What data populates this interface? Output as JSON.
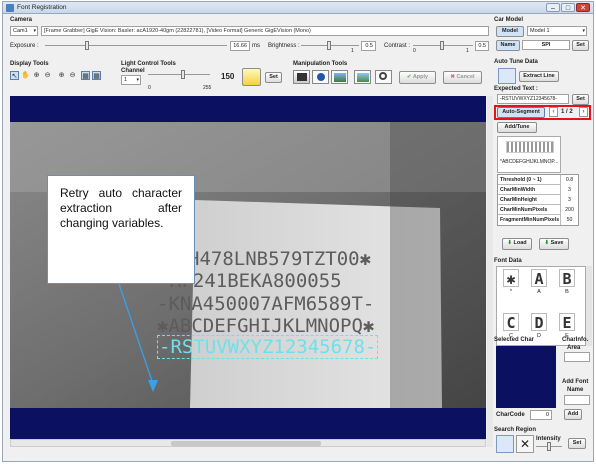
{
  "window": {
    "title": "Font Registration",
    "minimize": "–",
    "maximize": "□",
    "close": "✕"
  },
  "camera": {
    "section_label": "Camera",
    "selected": "Cam1",
    "info": "[Frame Grabber] GigE Vision: Basler: acA1920-40gm (22822781),   [Video Format] Generic GigEVision (Mono)",
    "exposure_label": "Exposure :",
    "exposure_value": "16.66",
    "exposure_unit": "ms",
    "brightness_label": "Brightness :",
    "brightness_value": "0.5",
    "brightness_min": "1",
    "contrast_label": "Contrast :",
    "contrast_value": "0.5",
    "contrast_min": "0",
    "contrast_max": "1"
  },
  "display_tools": {
    "label": "Display Tools"
  },
  "light_control": {
    "label": "Light Control Tools",
    "channel_label": "Channel",
    "channel_value": "1",
    "min": "0",
    "max": "255",
    "level_value": "150",
    "set_label": "Set"
  },
  "manipulation": {
    "label": "Manipulation Tools",
    "apply_label": "Apply",
    "cancel_label": "Cancel"
  },
  "image": {
    "lines": [
      "H478LNB579TZT00✱",
      "AF241BEKA800055",
      "-KNA450007AFM6589T-",
      "✱ABCDEFGHIJKLMNOPQ✱",
      "-RSTUVWXYZ12345678-"
    ]
  },
  "callout": {
    "text": "Retry auto character extraction after changing variables."
  },
  "car_model": {
    "label": "Car Model",
    "model_tab": "Model",
    "model_value": "Model 1",
    "name_tab": "Name",
    "name_value": "SPI",
    "set_label": "Set"
  },
  "auto_tune": {
    "label": "Auto Tune Data",
    "extract_label": "Extract Line",
    "expected_label": "Expected Text :",
    "expected_value": "-RSTUVWXYZ12345678-",
    "set_label": "Set",
    "auto_segment_label": "Auto-Segment",
    "page_indicator": "1 / 2",
    "add_tune_label": "Add/Tune",
    "preview_text": "*ABCDEFGHIJKLMNOP..."
  },
  "params": [
    {
      "name": "Threshold (0 ~ 1)",
      "value": "0.8"
    },
    {
      "name": "CharMinWidth",
      "value": "3"
    },
    {
      "name": "CharMinHeight",
      "value": "3"
    },
    {
      "name": "CharMinNumPixels",
      "value": "200"
    },
    {
      "name": "FragmentMinNumPixels",
      "value": "50"
    }
  ],
  "load_label": "Load",
  "save_label": "Save",
  "font_data": {
    "label": "Font Data",
    "glyphs": [
      {
        "char": "✱",
        "label": "*"
      },
      {
        "char": "A",
        "label": "A"
      },
      {
        "char": "B",
        "label": "B"
      },
      {
        "char": "C",
        "label": "C"
      },
      {
        "char": "D",
        "label": "D"
      },
      {
        "char": "E",
        "label": "E"
      }
    ]
  },
  "selected_char": {
    "label": "Selected Char",
    "info_label": "CharInfo.",
    "area_label": "Area",
    "add_font_label": "Add Font",
    "name_label": "Name",
    "charcode_label": "CharCode",
    "charcode_value": "0",
    "add_label": "Add"
  },
  "search_region": {
    "label": "Search Region",
    "intensity_label": "Intensity",
    "set_label": "Set"
  },
  "colors": {
    "accent_red": "#e4131b",
    "dark_navy": "#0b1060",
    "highlight_blue": "#cfe3f8"
  }
}
